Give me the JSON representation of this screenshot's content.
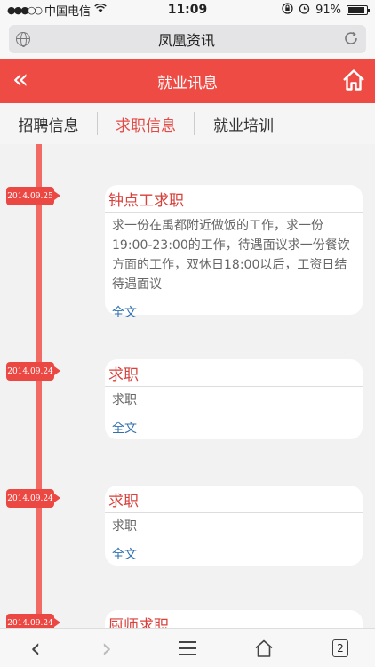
{
  "status_bar": {
    "carrier": "中国电信",
    "time": "11:09",
    "battery": "91%",
    "battery_level": 0.91,
    "signal_icon": "signal-dots-icon",
    "wifi_icon": "wifi-icon",
    "lock_icon": "orientation-lock-icon",
    "alarm_icon": "alarm-icon"
  },
  "address_bar": {
    "title": "凤凰资讯",
    "left_icon": "globe-icon",
    "right_icon": "reload-icon"
  },
  "header": {
    "title": "就业讯息",
    "back_glyph": "«",
    "color": "#ef4b45"
  },
  "tabs": [
    {
      "label": "招聘信息",
      "active": false
    },
    {
      "label": "求职信息",
      "active": true
    },
    {
      "label": "就业培训",
      "active": false
    }
  ],
  "timeline": {
    "items": [
      {
        "date": "2014.09.25",
        "title": "钟点工求职",
        "body": "求一份在禹都附近做饭的工作，求一份19:00-23:00的工作，待遇面议求一份餐饮方面的工作，双休日18:00以后，工资日结待遇面议",
        "more": "全文"
      },
      {
        "date": "2014.09.24",
        "title": "求职",
        "body": "求职",
        "more": "全文"
      },
      {
        "date": "2014.09.24",
        "title": "求职",
        "body": "求职",
        "more": "全文"
      },
      {
        "date": "2014.09.24",
        "title": "厨师求职",
        "body": "",
        "more": ""
      }
    ]
  },
  "bottom_bar": {
    "back_glyph": "‹",
    "forward_glyph": "›",
    "tab_count": "2"
  }
}
